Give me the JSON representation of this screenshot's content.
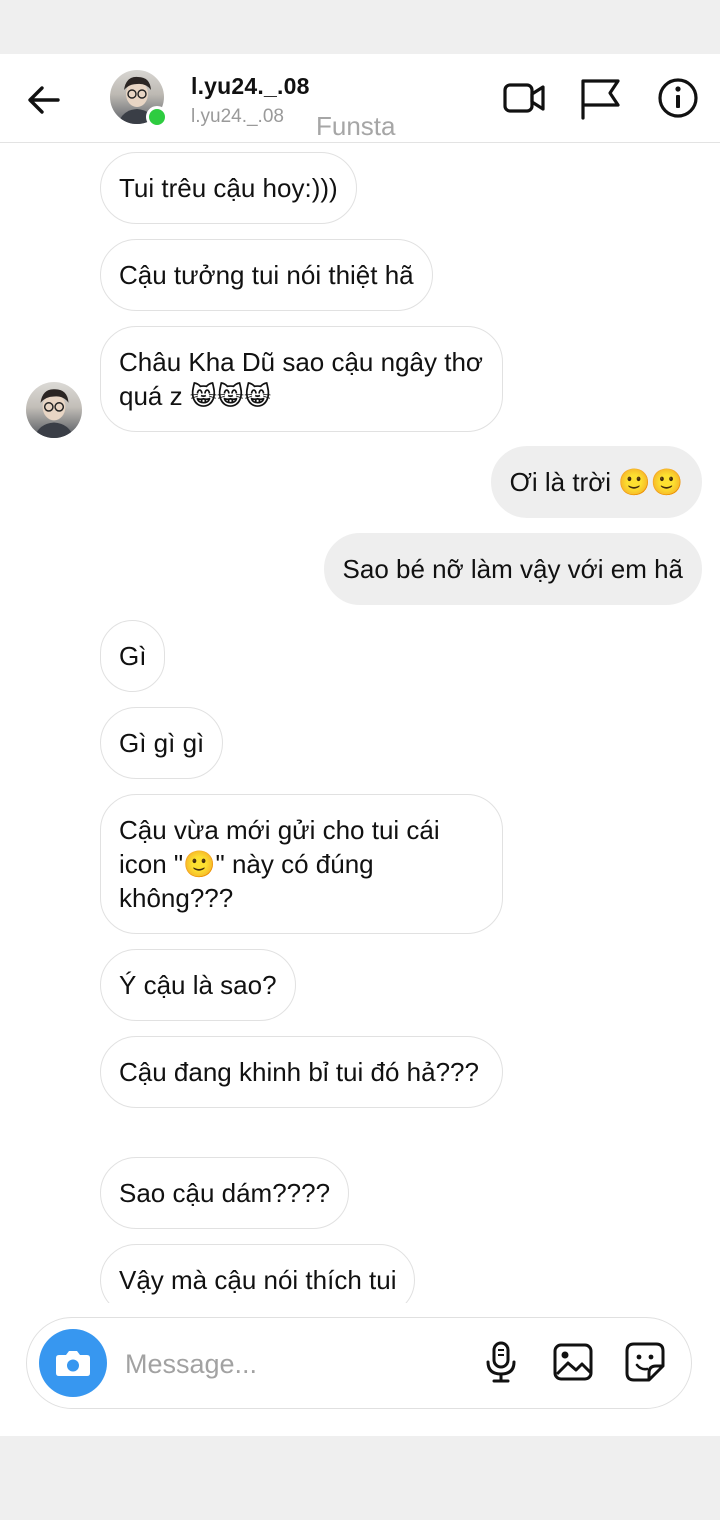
{
  "header": {
    "username": "l.yu24._.08",
    "subtitle": "l.yu24._.08",
    "tag": "Funsta"
  },
  "messages": [
    {
      "side": "received",
      "text": "Tui trêu cậu hoy:)))"
    },
    {
      "side": "received",
      "text": "Cậu tưởng tui nói thiệt hã"
    },
    {
      "side": "received",
      "text": "Châu Kha Dũ sao cậu ngây thơ quá z 😸😸😸"
    },
    {
      "side": "sent",
      "text": "Ơi là trời 🙂🙂"
    },
    {
      "side": "sent",
      "text": "Sao bé nỡ làm vậy với em hã"
    },
    {
      "side": "received",
      "text": "Gì"
    },
    {
      "side": "received",
      "text": "Gì gì gì"
    },
    {
      "side": "received",
      "text": "Cậu vừa mới gửi cho tui cái icon \"🙂\" này có đúng không???"
    },
    {
      "side": "received",
      "text": "Ý cậu là sao?"
    },
    {
      "side": "received",
      "text": "Cậu đang khinh bỉ tui đó hả???"
    },
    {
      "side": "received",
      "text": "Sao cậu dám????"
    },
    {
      "side": "received",
      "text": "Vậy mà cậu nói thích tui"
    }
  ],
  "composer": {
    "placeholder": "Message..."
  },
  "colors": {
    "accent": "#3797f0",
    "online": "#2ecc40",
    "sent_bubble": "#eeeeee"
  }
}
